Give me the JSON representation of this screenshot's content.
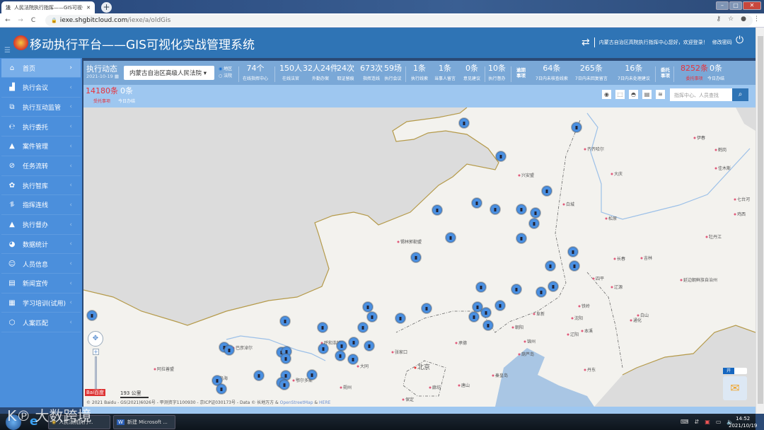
{
  "browser": {
    "tab_title": "人民法院执行指挥——GIS可视化",
    "url_host": "iexe.shgbitcloud.com",
    "url_path": "/iexe/a/oldGis"
  },
  "header": {
    "title": "移动执行平台——GIS可视化实战管理系统",
    "welcome": "内蒙古自治区高院执行指挥中心您好，欢迎登录！",
    "change_password": "修改密码"
  },
  "sidebar": {
    "items": [
      {
        "label": "首页",
        "icon": "home-icon"
      },
      {
        "label": "执行会议",
        "icon": "meeting-icon"
      },
      {
        "label": "执行互动监管",
        "icon": "interact-icon"
      },
      {
        "label": "执行委托",
        "icon": "entrust-icon"
      },
      {
        "label": "案件管理",
        "icon": "case-icon"
      },
      {
        "label": "任务流转",
        "icon": "task-icon"
      },
      {
        "label": "执行智库",
        "icon": "library-icon"
      },
      {
        "label": "指挥连线",
        "icon": "connect-icon"
      },
      {
        "label": "执行督办",
        "icon": "supervise-icon"
      },
      {
        "label": "数据统计",
        "icon": "pie-chart-icon"
      },
      {
        "label": "人员信息",
        "icon": "person-icon"
      },
      {
        "label": "新闻宣传",
        "icon": "news-icon"
      },
      {
        "label": "学习培训(试用)",
        "icon": "training-icon"
      },
      {
        "label": "人案匹配",
        "icon": "match-icon"
      }
    ]
  },
  "dynamics": {
    "title": "执行动态",
    "date": "2021-10-19",
    "court_select": "内蒙古自治区高级人民法院",
    "radio_region": "地区",
    "radio_court": "法院"
  },
  "stats": [
    {
      "value": "74个",
      "label": "在线指挥中心"
    },
    {
      "value": "150人",
      "label": "在线法官"
    },
    {
      "value": "32人24件",
      "label": "外勤办案"
    },
    {
      "value": "24次",
      "label": "取证留痕"
    },
    {
      "value": "673次",
      "label": "指挥连线"
    },
    {
      "value": "59场",
      "label": "执行会议"
    },
    {
      "value": "1条",
      "label": "执行线索"
    },
    {
      "value": "1条",
      "label": "当事人留言"
    },
    {
      "value": "0条",
      "label": "意见建议"
    },
    {
      "value": "10条",
      "label": "执行督办"
    }
  ],
  "overdue": {
    "group_label": "逾期事项",
    "items": [
      {
        "value": "64条",
        "label": "7日内未核查线索"
      },
      {
        "value": "265条",
        "label": "7日内未回复留言"
      },
      {
        "value": "16条",
        "label": "7日内未处理建议"
      }
    ]
  },
  "entrust": {
    "group_label": "委托事项",
    "items": [
      {
        "value": "8252条",
        "label": "委托事项",
        "highlight": true
      },
      {
        "value": "0条",
        "label": "今日办结"
      }
    ],
    "row2": [
      {
        "value": "14180条",
        "label": "受托事项",
        "highlight": true
      },
      {
        "value": "0条",
        "label": "今日办结"
      }
    ]
  },
  "map": {
    "search_placeholder": "指挥中心、人员查找",
    "scale": "193 公里",
    "copyright": "© 2021 Baidu - GS(2021)6026号 - 甲测资字1100930 - 京ICP证030173号 - Data © 长地万方 & ",
    "osm": "OpenStreetMap",
    "amp": " & ",
    "here": "HERE",
    "toggle_label": "开",
    "cities": [
      "伊春",
      "齐齐哈尔",
      "鹤岗",
      "佳木斯",
      "大庆",
      "兴安盟",
      "白城",
      "七台河",
      "松原",
      "鸡西",
      "牡丹江",
      "锡林郭勒盟",
      "呼和浩特",
      "长春",
      "吉林",
      "四平",
      "辽源",
      "延边朝鲜族自治州",
      "铁岭",
      "阜新",
      "沈阳",
      "本溪",
      "通化",
      "白山",
      "辽阳",
      "朝阳",
      "锦州",
      "承德",
      "张家口",
      "葫芦岛",
      "北京",
      "秦皇岛",
      "唐山",
      "廊坊",
      "丹东",
      "大同",
      "朔州",
      "阿拉善盟",
      "巴彦淖尔",
      "鄂尔多斯",
      "乌海",
      "保定"
    ],
    "accent": "#4a90e2"
  },
  "taskbar": {
    "chrome_label": "人民法院执行...",
    "word_label": "新建 Microsoft ...",
    "time": "14:52",
    "date": "2021/10/19"
  },
  "colors": {
    "header": "#2f74b5",
    "sidebar": "#4b8fdc",
    "alert": "#e8323a"
  }
}
